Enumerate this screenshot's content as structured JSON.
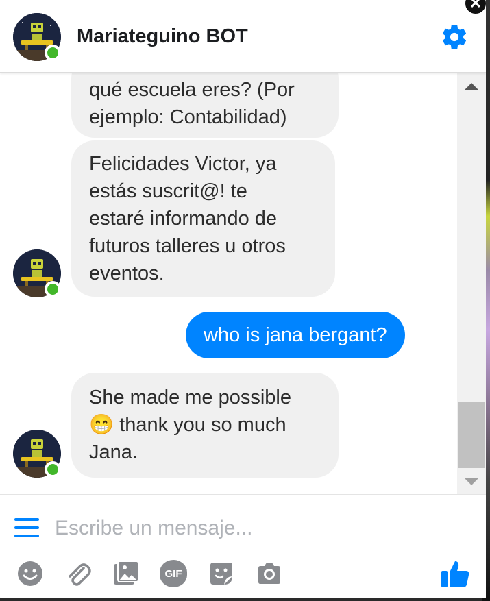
{
  "header": {
    "title": "Mariateguino BOT",
    "close_icon": "close-icon",
    "settings_icon": "gear-icon"
  },
  "messages": [
    {
      "from": "bot",
      "text_lines": [
        "qué escuela eres? (Por",
        "ejemplo: Contabilidad)"
      ]
    },
    {
      "from": "bot",
      "text_lines": [
        "Felicidades Victor, ya",
        "estás suscrit@! te",
        "estaré informando de",
        "futuros talleres u otros",
        "eventos."
      ]
    },
    {
      "from": "user",
      "text": "who is jana bergant?"
    },
    {
      "from": "bot",
      "text_lines": [
        "She made me possible",
        "😁 thank you so much",
        "Jana."
      ]
    }
  ],
  "composer": {
    "placeholder": "Escribe un mensaje...",
    "tools": [
      "smiley-icon",
      "paperclip-icon",
      "image-icon",
      "gif-icon",
      "sticker-icon",
      "camera-icon"
    ],
    "gif_label": "GIF",
    "send_icon": "thumbs-up-icon"
  },
  "colors": {
    "accent": "#0084ff",
    "bubble_in": "#f0f0f0",
    "online": "#42b72a",
    "icon_gray": "#888a8e"
  }
}
